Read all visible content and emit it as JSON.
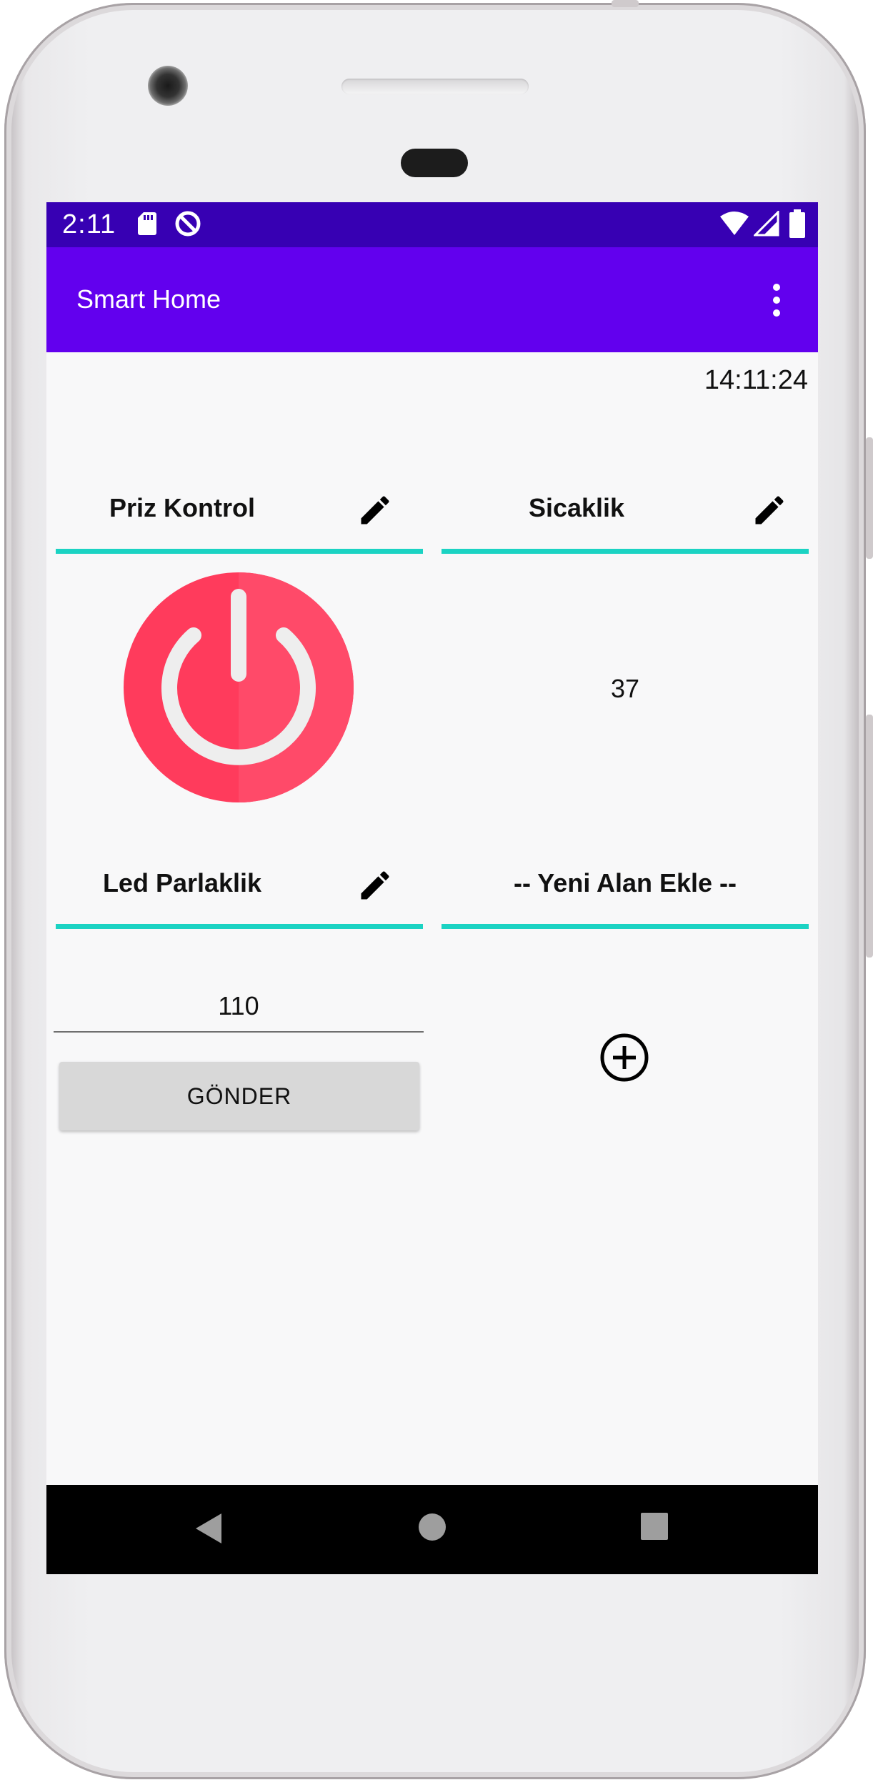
{
  "status_bar": {
    "time": "2:11",
    "icons": [
      "sd-card-icon",
      "data-saver-icon",
      "wifi-icon",
      "signal-icon",
      "battery-icon"
    ]
  },
  "app_bar": {
    "title": "Smart Home",
    "menu_icon": "overflow-menu-icon"
  },
  "clock": "14:11:24",
  "panels": {
    "socket": {
      "title": "Priz Kontrol",
      "edit_icon": "pencil-icon",
      "power_icon": "power-icon",
      "power_color": "#ff3b5c"
    },
    "temperature": {
      "title": "Sicaklik",
      "edit_icon": "pencil-icon",
      "value": "37"
    },
    "led": {
      "title": "Led Parlaklik",
      "edit_icon": "pencil-icon",
      "input_value": "110",
      "send_label": "GÖNDER"
    },
    "new_field": {
      "title": "-- Yeni Alan Ekle --",
      "add_icon": "add-circle-icon"
    }
  },
  "nav_bar": {
    "buttons": [
      "back-icon",
      "home-icon",
      "recents-icon"
    ]
  },
  "colors": {
    "status_bar": "#3700b3",
    "app_bar": "#6200ee",
    "divider": "#1bd3c3",
    "power": "#ff3b5c"
  }
}
